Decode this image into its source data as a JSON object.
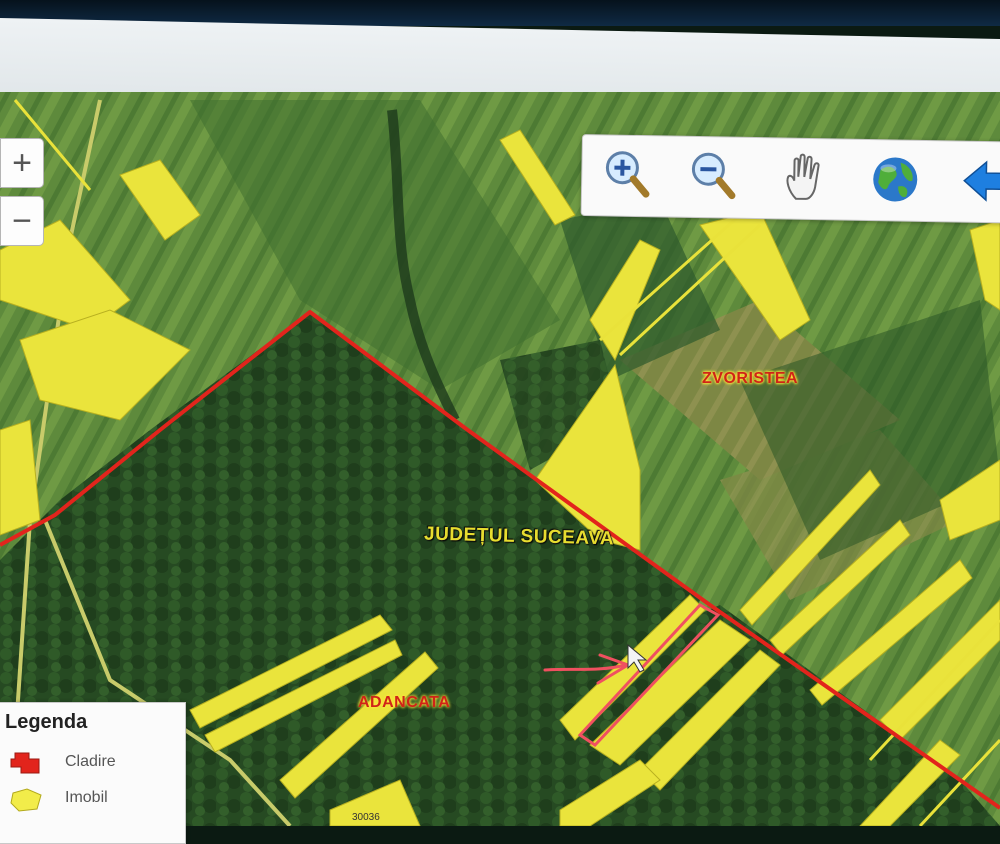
{
  "screen": {
    "bezel_color": "#0f2a44"
  },
  "map": {
    "labels": {
      "zvoristea": "ZVORISTEA",
      "judet": "JUDEȚUL SUCEAVA",
      "adancata": "ADANCATA",
      "parcel_number": "30036"
    },
    "colors": {
      "forest": "#274a22",
      "field": "#5f8a3a",
      "parcel_fill": "#e9e23a",
      "boundary": "#e2241c",
      "annotation": "#f05060"
    }
  },
  "zoom_controls": {
    "zoom_in_glyph": "+",
    "zoom_out_glyph": "−"
  },
  "map_tools": [
    {
      "name": "zoom-in",
      "icon": "magnifier-plus-icon"
    },
    {
      "name": "zoom-out",
      "icon": "magnifier-minus-icon"
    },
    {
      "name": "pan",
      "icon": "hand-icon"
    },
    {
      "name": "full-extent",
      "icon": "globe-icon"
    },
    {
      "name": "back",
      "icon": "arrow-left-icon"
    }
  ],
  "legend": {
    "title": "Legenda",
    "items": [
      {
        "label": "Cladire",
        "color": "#e2241c",
        "icon": "building-icon"
      },
      {
        "label": "Imobil",
        "color": "#f2ec4a",
        "icon": "parcel-icon"
      }
    ]
  }
}
